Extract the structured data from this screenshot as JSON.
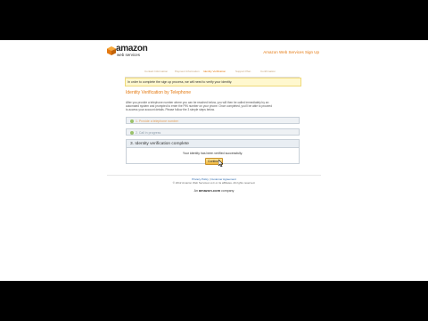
{
  "brand": {
    "name": "amazon",
    "subtitle": "web services",
    "logo_icon": "aws-cube-icon",
    "accent": "#e47911"
  },
  "header": {
    "link": "Amazon Web Services Sign Up"
  },
  "steps": [
    "Contact Information",
    "Payment Information",
    "Identity Verification",
    "Support Plan",
    "Confirmation"
  ],
  "notice": "In order to complete the sign up process, we will need to verify your identity.",
  "page_title": "Identity Verification by Telephone",
  "intro": [
    "After you provide a telephone number where you can be reached below, you will then be called immediately by an",
    "automated system and prompted to enter the PIN number on your phone. Once completed, you'll be able to proceed",
    "to access your account details. Please follow the 3 simple steps below."
  ],
  "sections": [
    {
      "label": "1. Provide a telephone number",
      "status": "done"
    },
    {
      "label": "2. Call in progress",
      "status": "done"
    }
  ],
  "panel": {
    "title": "3. Identity verification complete",
    "message": "Your identity has been verified successfully.",
    "continue_label": "Continue"
  },
  "footer": {
    "privacy": "Privacy Policy",
    "separator": "|",
    "terms": "Customer Agreement",
    "copyright": "© 2012 Amazon Web Services LLC or its affiliates. All rights reserved.",
    "company_prefix": "An",
    "company_brand": "amazon.com",
    "company_suffix": "company"
  }
}
